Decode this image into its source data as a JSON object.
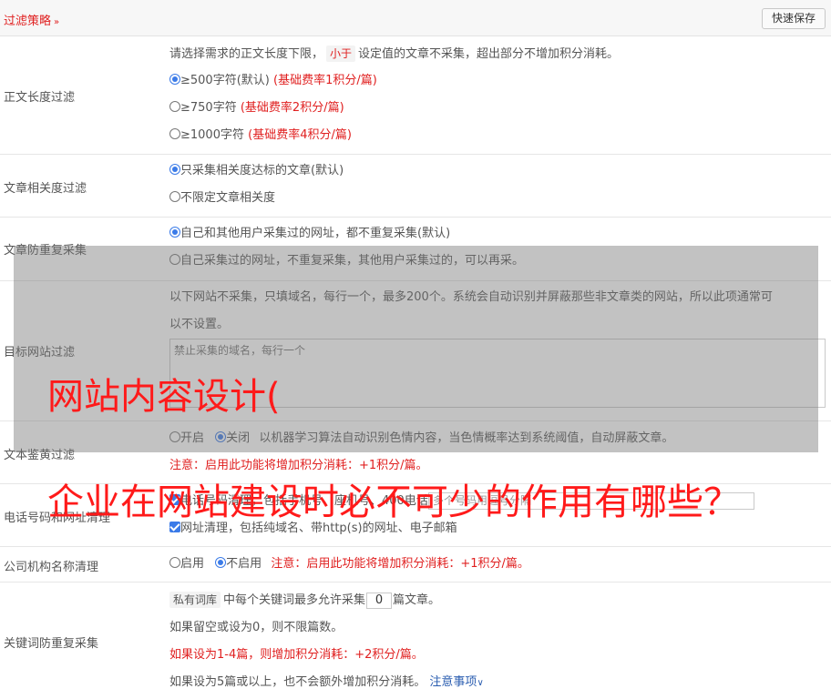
{
  "header": {
    "title": "过滤策略",
    "save_label": "快速保存"
  },
  "sections": {
    "length": {
      "label": "正文长度过滤",
      "desc_pre": "请选择需求的正文长度下限，",
      "desc_pill": "小于",
      "desc_post": "设定值的文章不采集，超出部分不增加积分消耗。",
      "options": [
        {
          "text": "≥500字符(默认)",
          "note": "(基础费率1积分/篇)"
        },
        {
          "text": "≥750字符",
          "note": "(基础费率2积分/篇)"
        },
        {
          "text": "≥1000字符",
          "note": "(基础费率4积分/篇)"
        }
      ]
    },
    "relevance": {
      "label": "文章相关度过滤",
      "options": [
        "只采集相关度达标的文章(默认)",
        "不限定文章相关度"
      ]
    },
    "dedupe": {
      "label": "文章防重复采集",
      "options": [
        "自己和其他用户采集过的网址，都不重复采集(默认)",
        "自己采集过的网址，不重复采集，其他用户采集过的，可以再采。"
      ]
    },
    "target": {
      "label": "目标网站过滤",
      "desc1": "以下网站不采集，只填域名，每行一个，最多200个。系统会自动识别并屏蔽那些非文章类的网站，所以此项通常可",
      "desc2": "以不设置。",
      "placeholder": "禁止采集的域名，每行一个"
    },
    "porn": {
      "label": "文本鉴黄过滤",
      "on": "开启",
      "off": "关闭",
      "desc": "以机器学习算法自动识别色情内容，当色情概率达到系统阈值，自动屏蔽文章。",
      "warn": "注意：启用此功能将增加积分消耗：+1积分/篇。"
    },
    "phone": {
      "label": "电话号码和网址清理",
      "line1_hidden": "电话号码清理，包括手机号、座机号、400电话格式，同时保留以下号码：",
      "input_hint": "多个号码用逗号分隔",
      "line2": "网址清理，包括纯域名、带http(s)的网址、电子邮箱"
    },
    "company": {
      "label": "公司机构名称清理",
      "on": "启用",
      "off": "不启用",
      "warn": "注意：启用此功能将增加积分消耗：+1积分/篇。"
    },
    "keyword": {
      "label": "关键词防重复采集",
      "pill": "私有词库",
      "pre": "中每个关键词最多允许采集",
      "value": "0",
      "post": "篇文章。",
      "line2": "如果留空或设为0，则不限篇数。",
      "line3": "如果设为1-4篇，则增加积分消耗：+2积分/篇。",
      "line4": "如果设为5篇或以上，也不会额外增加积分消耗。",
      "link": "注意事项"
    }
  },
  "overlay": {
    "title_line1": "网站内容设计(",
    "title_line2": "企业在网站建设时必不可少的作用有哪些？"
  },
  "colors": {
    "accent_red": "#e02020",
    "radio_blue": "#3b7be8",
    "overlay_red": "#ff1a1a"
  }
}
